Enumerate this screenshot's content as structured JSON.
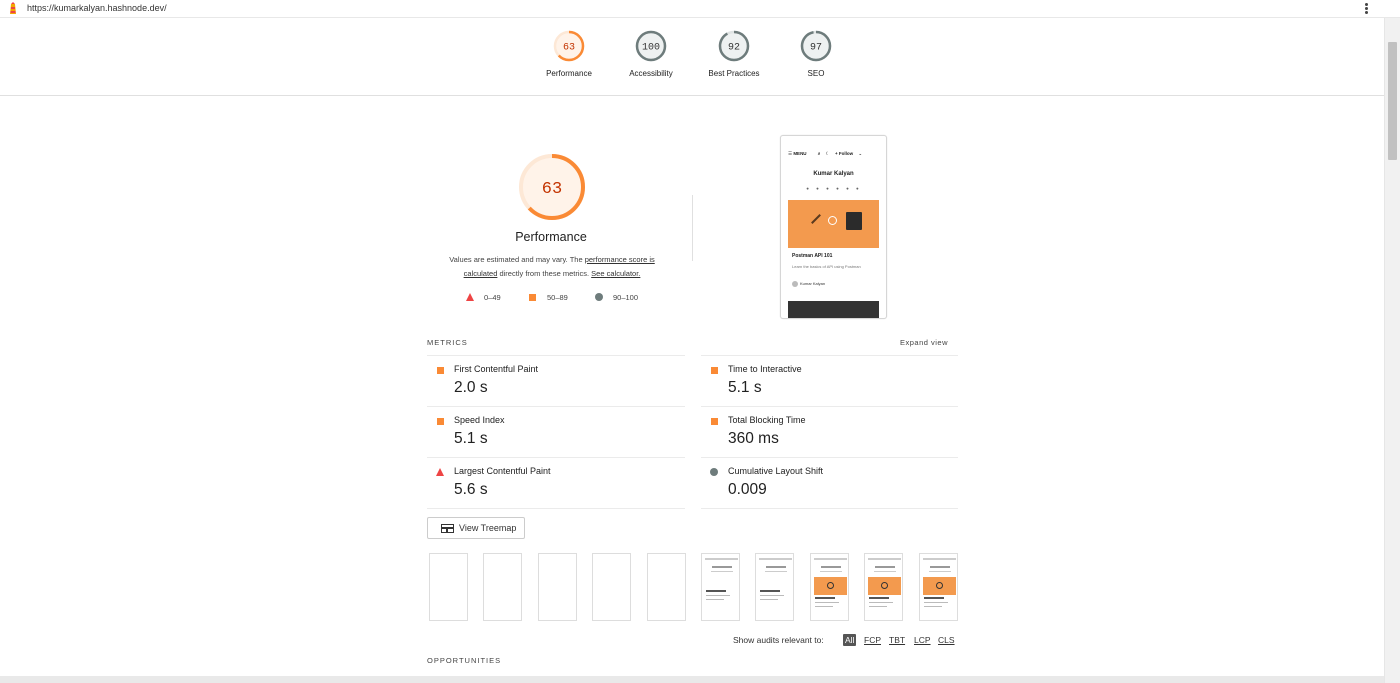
{
  "url_bar": {
    "url": "https://kumarkalyan.hashnode.dev/"
  },
  "header_gauges": [
    {
      "score": "63",
      "label": "Performance",
      "color": "#fa8a35",
      "fraction": 0.63
    },
    {
      "score": "100",
      "label": "Accessibility",
      "color": "#6e7c7c",
      "fraction": 1.0
    },
    {
      "score": "92",
      "label": "Best Practices",
      "color": "#6e7c7c",
      "fraction": 0.92
    },
    {
      "score": "97",
      "label": "SEO",
      "color": "#6e7c7c",
      "fraction": 0.97
    }
  ],
  "performance": {
    "score": "63",
    "fraction": 0.63,
    "title": "Performance",
    "desc_1": "Values are estimated and may vary. The ",
    "desc_link_1": "performance score is calculated",
    "desc_2": " directly from these metrics. ",
    "desc_link_2": "See calculator."
  },
  "legend": [
    {
      "shape": "triangle",
      "range": "0–49",
      "color": "#e44"
    },
    {
      "shape": "square",
      "range": "50–89",
      "color": "#fa8a35"
    },
    {
      "shape": "circle",
      "range": "90–100",
      "color": "#6e7c7c"
    }
  ],
  "screenshot_preview": {
    "nav": "MENU",
    "follow": "Follow",
    "author_name": "Kumar Kalyan",
    "post_title": "Postman API 101",
    "post_sub": "Learn the basics of API using Postman",
    "post_author": "Kumar Kalyan"
  },
  "metrics": {
    "header": "METRICS",
    "expand": "Expand view",
    "items": [
      {
        "name": "First Contentful Paint",
        "value": "2.0 s",
        "status": "square"
      },
      {
        "name": "Time to Interactive",
        "value": "5.1 s",
        "status": "square"
      },
      {
        "name": "Speed Index",
        "value": "5.1 s",
        "status": "square"
      },
      {
        "name": "Total Blocking Time",
        "value": "360 ms",
        "status": "square"
      },
      {
        "name": "Largest Contentful Paint",
        "value": "5.6 s",
        "status": "triangle"
      },
      {
        "name": "Cumulative Layout Shift",
        "value": "0.009",
        "status": "circle"
      }
    ]
  },
  "treemap_button": {
    "label": "View Treemap"
  },
  "audit_filter": {
    "label": "Show audits relevant to:",
    "chips": [
      "All",
      "FCP",
      "TBT",
      "LCP",
      "CLS"
    ],
    "active": "All"
  },
  "opportunities": {
    "header": "OPPORTUNITIES"
  }
}
